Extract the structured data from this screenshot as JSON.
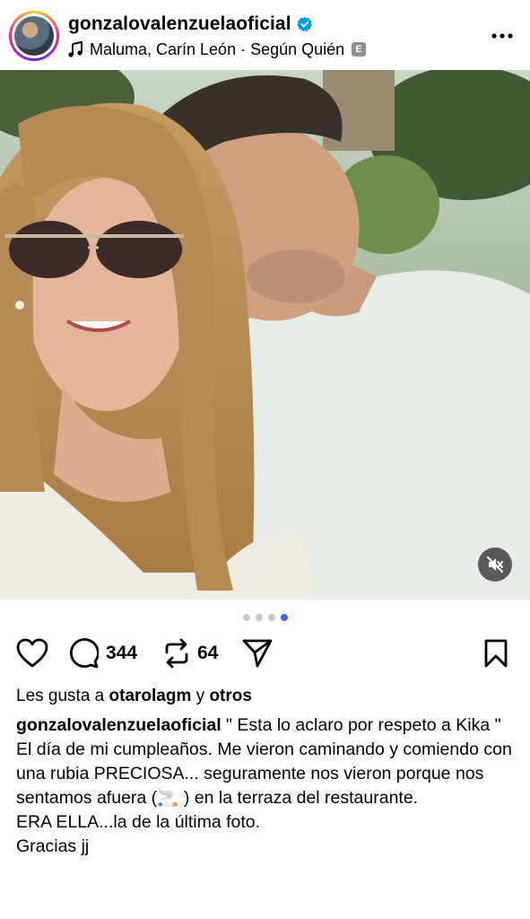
{
  "post": {
    "username": "gonzalovalenzuelaoficial",
    "verified": true,
    "music": "Maluma, Carín León · Según Quién",
    "explicit_badge": "E",
    "more_icon": "more-horizontal-icon"
  },
  "carousel": {
    "count": 4,
    "active_index": 3
  },
  "actions": {
    "comments": "344",
    "reposts": "64",
    "icons": [
      "heart-icon",
      "comment-icon",
      "repost-icon",
      "share-icon",
      "bookmark-icon"
    ]
  },
  "likes": {
    "prefix": "Les gusta a ",
    "user": "otarolagm",
    "joiner": " y ",
    "others": "otros"
  },
  "caption": {
    "username": "gonzalovalenzuelaoficial",
    "line1": " \" Esta lo aclaro por respeto a Kika \"",
    "line2": "El día de mi cumpleaños. Me vieron caminando y comiendo con una rubia PRECIOSA... seguramente nos vieron  porque nos sentamos afuera (",
    "emoji": "🚬",
    "line2b": " ) en la terraza del restaurante.",
    "line3": "ERA ELLA...la de la última foto.",
    "line4": "Gracias jj"
  },
  "colors": {
    "accent_blue": "#3a66f0",
    "verified_blue": "#0095f6"
  }
}
